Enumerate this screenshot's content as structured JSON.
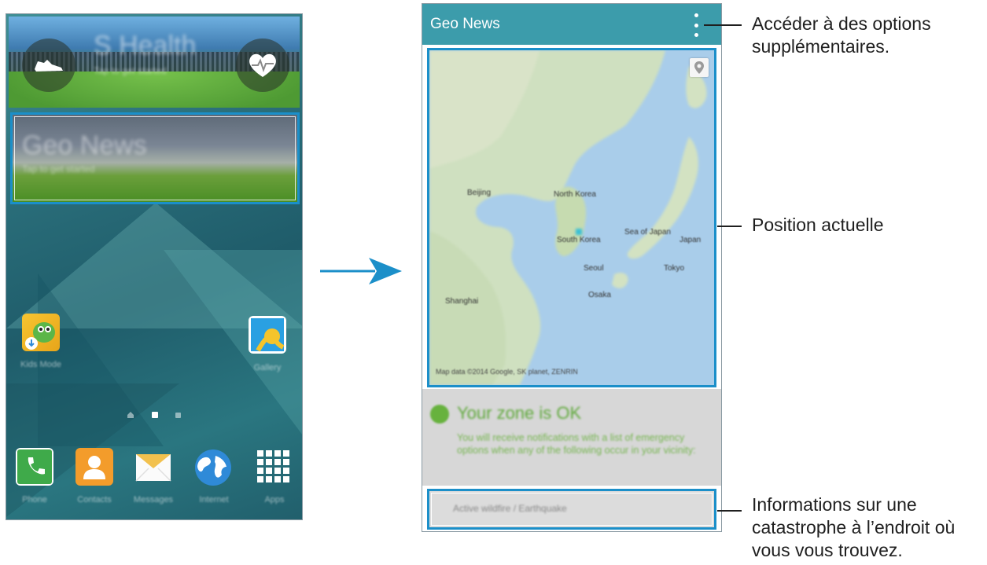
{
  "home_screen": {
    "shealth_widget": {
      "title": "S Health",
      "subtitle": "Tap to get started",
      "left_icon": "shoe-icon",
      "right_icon": "heart-rate-icon"
    },
    "geo_news_widget": {
      "title": "Geo News",
      "subtitle": "Tap to get started"
    },
    "desktop_apps": [
      {
        "label": "Kids Mode",
        "icon": "kids-mode-icon"
      },
      {
        "label": "Gallery",
        "icon": "gallery-icon"
      }
    ],
    "page_indicator": {
      "pages": [
        "home",
        "page",
        "page"
      ],
      "current": 1
    },
    "dock": [
      {
        "label": "Phone",
        "icon": "phone-icon",
        "color": "#4caf50"
      },
      {
        "label": "Contacts",
        "icon": "contacts-icon",
        "color": "#f39c2b"
      },
      {
        "label": "Messages",
        "icon": "messages-icon",
        "color": "#f2c14e"
      },
      {
        "label": "Internet",
        "icon": "globe-icon",
        "color": "#2f8ad8"
      },
      {
        "label": "Apps",
        "icon": "apps-grid-icon",
        "color": "#ffffff"
      }
    ]
  },
  "geo_news_app": {
    "title": "Geo News",
    "menu_icon": "more-options-icon",
    "accent_color": "#3c9cab",
    "highlight_color": "#1b8fc9",
    "map": {
      "labels": {
        "north_korea": "North Korea",
        "south_korea": "South Korea",
        "japan": "Japan",
        "beijing": "Beijing",
        "shanghai": "Shanghai",
        "seoul": "Seoul",
        "osaka": "Osaka",
        "tokyo": "Tokyo",
        "sea_of_japan": "Sea of Japan"
      },
      "attribution": "Map data ©2014 Google, SK planet, ZENRIN"
    },
    "status": {
      "title": "Your zone is OK",
      "description": "You will receive notifications with a list of emergency options when any of the following occur in your vicinity:"
    },
    "disaster_row": {
      "label": "Active wildfire / Earthquake"
    }
  },
  "callouts": {
    "options": "Accéder à des options supplémentaires.",
    "position": "Position actuelle",
    "disaster": "Informations sur une catastrophe à l’endroit où vous vous trouvez."
  }
}
